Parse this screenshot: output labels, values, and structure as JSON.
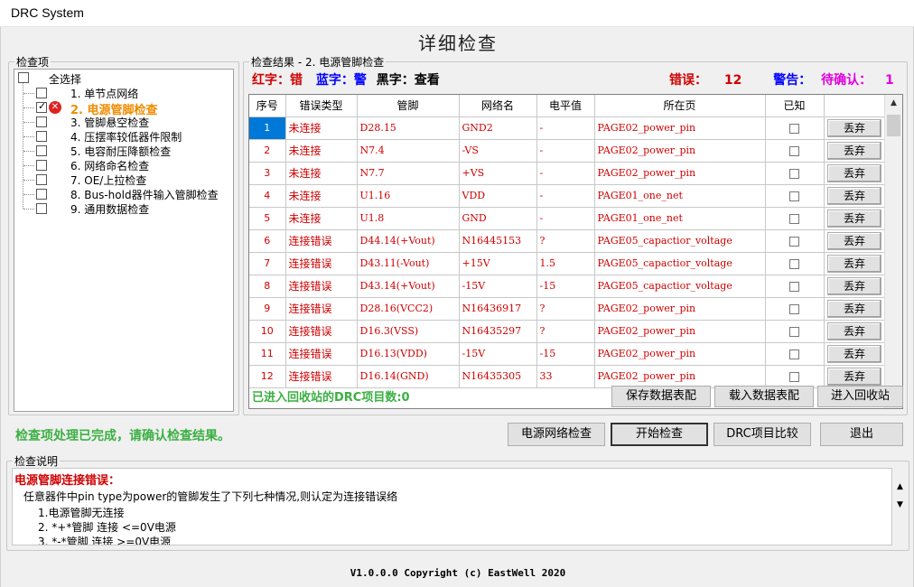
{
  "window": {
    "title": "DRC System"
  },
  "main_title": "详细检查",
  "check_items": {
    "legend": "检查项",
    "select_all": "全选择",
    "items": [
      {
        "label": "1. 单节点网络",
        "checked": false,
        "active": false
      },
      {
        "label": "2. 电源管脚检查",
        "checked": true,
        "active": true
      },
      {
        "label": "3. 管脚悬空检查",
        "checked": false,
        "active": false
      },
      {
        "label": "4. 压摆率较低器件限制",
        "checked": false,
        "active": false
      },
      {
        "label": "5. 电容耐压降额检查",
        "checked": false,
        "active": false
      },
      {
        "label": "6. 网络命名检查",
        "checked": false,
        "active": false
      },
      {
        "label": "7. OE/上拉检查",
        "checked": false,
        "active": false
      },
      {
        "label": "8. Bus-hold器件输入管脚检查",
        "checked": false,
        "active": false
      },
      {
        "label": "9. 通用数据检查",
        "checked": false,
        "active": false
      }
    ]
  },
  "results": {
    "legend": "检查结果 - 2. 电源管脚检查",
    "legend_red": "红字：错",
    "legend_blue": "蓝字：警",
    "legend_black": "黑字：查看",
    "errors_label": "错误：",
    "errors_count": "12",
    "warnings_label": "警告：",
    "pending_label": "待确认：",
    "pending_count": "1",
    "columns": [
      "序号",
      "错误类型",
      "管脚",
      "网络名",
      "电平值",
      "所在页",
      "已知",
      ""
    ],
    "discard_label": "丢弃",
    "rows": [
      {
        "no": "1",
        "type": "未连接",
        "pin": "D28.15",
        "net": "GND2",
        "level": "-",
        "page": "PAGE02_power_pin"
      },
      {
        "no": "2",
        "type": "未连接",
        "pin": "N7.4",
        "net": "-VS",
        "level": "-",
        "page": "PAGE02_power_pin"
      },
      {
        "no": "3",
        "type": "未连接",
        "pin": "N7.7",
        "net": "+VS",
        "level": "-",
        "page": "PAGE02_power_pin"
      },
      {
        "no": "4",
        "type": "未连接",
        "pin": "U1.16",
        "net": "VDD",
        "level": "-",
        "page": "PAGE01_one_net"
      },
      {
        "no": "5",
        "type": "未连接",
        "pin": "U1.8",
        "net": "GND",
        "level": "-",
        "page": "PAGE01_one_net"
      },
      {
        "no": "6",
        "type": "连接错误",
        "pin": "D44.14(+Vout)",
        "net": "N16445153",
        "level": "?",
        "page": "PAGE05_capactior_voltage"
      },
      {
        "no": "7",
        "type": "连接错误",
        "pin": "D43.11(-Vout)",
        "net": "+15V",
        "level": "1.5",
        "page": "PAGE05_capactior_voltage"
      },
      {
        "no": "8",
        "type": "连接错误",
        "pin": "D43.14(+Vout)",
        "net": "-15V",
        "level": "-15",
        "page": "PAGE05_capactior_voltage"
      },
      {
        "no": "9",
        "type": "连接错误",
        "pin": "D28.16(VCC2)",
        "net": "N16436917",
        "level": "?",
        "page": "PAGE02_power_pin"
      },
      {
        "no": "10",
        "type": "连接错误",
        "pin": "D16.3(VSS)",
        "net": "N16435297",
        "level": "?",
        "page": "PAGE02_power_pin"
      },
      {
        "no": "11",
        "type": "连接错误",
        "pin": "D16.13(VDD)",
        "net": "-15V",
        "level": "-15",
        "page": "PAGE02_power_pin"
      },
      {
        "no": "12",
        "type": "连接错误",
        "pin": "D16.14(GND)",
        "net": "N16435305",
        "level": "33",
        "page": "PAGE02_power_pin"
      }
    ],
    "recycle_status": "已进入回收站的DRC项目数:0",
    "btn_save": "保存数据表配",
    "btn_load": "载入数据表配",
    "btn_recycle": "进入回收站"
  },
  "status_message": "检查项处理已完成，请确认检查结果。",
  "buttons": {
    "power_net": "电源网络检查",
    "start": "开始检查",
    "compare": "DRC项目比较",
    "exit": "退出"
  },
  "description": {
    "legend": "检查说明",
    "heading": "电源管脚连接错误：",
    "intro": "任意器件中pin type为power的管脚发生了下列七种情况,则认定为连接错误络",
    "lines": [
      "1.电源管脚无连接",
      "2. *+*管脚 连接 <=0V电源",
      "3. *-*管脚 连接 >=0V电源"
    ]
  },
  "footer": "V1.0.0.0  Copyright (c) EastWell 2020",
  "colors": {
    "error": "#d00000",
    "warning": "#0000ff",
    "pending": "#e000e0",
    "success": "#3cb043",
    "selection": "#0078d7"
  }
}
